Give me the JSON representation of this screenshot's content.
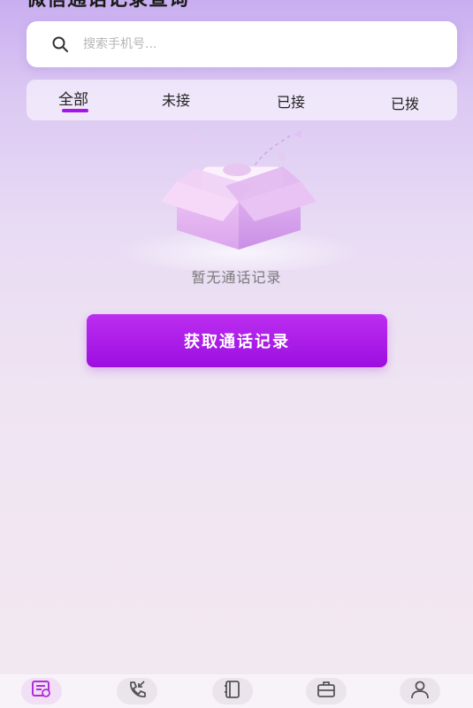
{
  "header": {
    "title": "微信通话记录查询"
  },
  "search": {
    "placeholder": "搜索手机号..."
  },
  "tabs": [
    {
      "label": "全部",
      "active": true
    },
    {
      "label": "未接",
      "active": false
    },
    {
      "label": "已接",
      "active": false
    },
    {
      "label": "已拨",
      "active": false
    }
  ],
  "empty_state": {
    "text": "暂无通话记录",
    "icon": "empty-box-illustration"
  },
  "action": {
    "fetch_label": "获取通话记录"
  },
  "bottom_nav": [
    {
      "icon": "call-log-icon",
      "active": true
    },
    {
      "icon": "incoming-call-icon",
      "active": false
    },
    {
      "icon": "contacts-book-icon",
      "active": false
    },
    {
      "icon": "toolbox-icon",
      "active": false
    },
    {
      "icon": "user-profile-icon",
      "active": false
    }
  ],
  "colors": {
    "accent": "#a415e6",
    "button": "#aa1ee8",
    "icon_active": "#b02fd8",
    "icon_inactive": "#555555"
  }
}
